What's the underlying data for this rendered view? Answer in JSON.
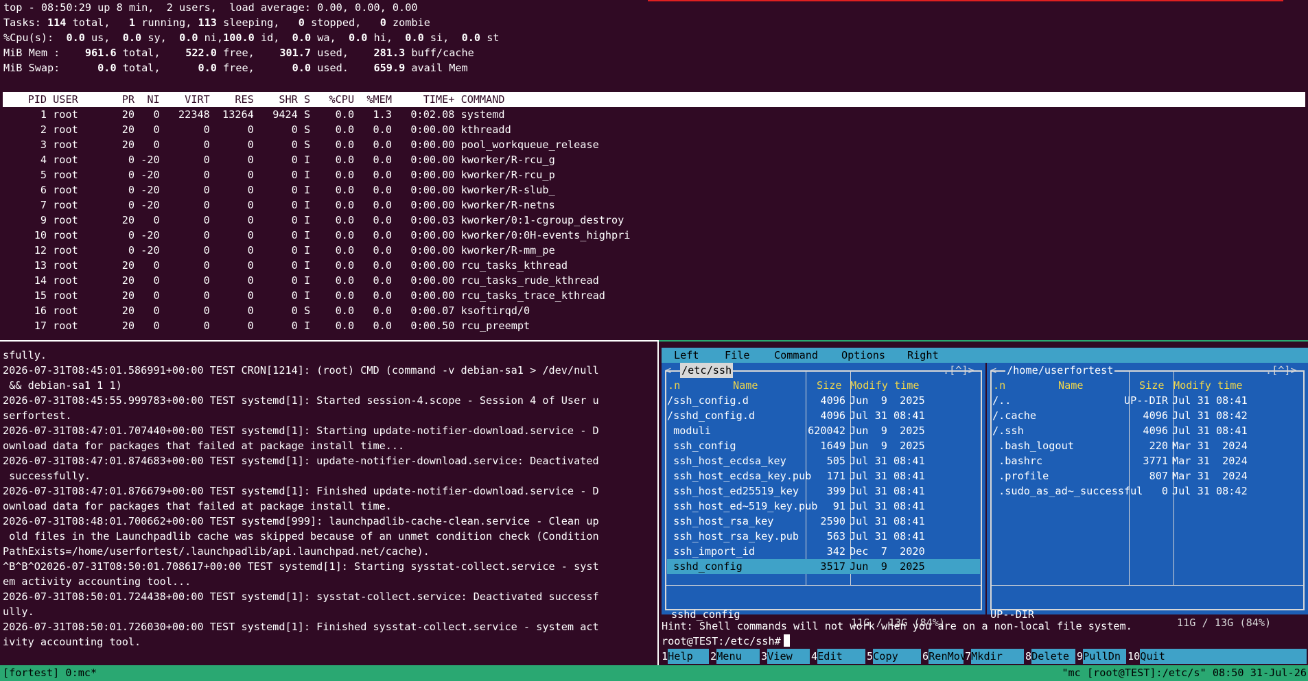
{
  "top": {
    "summary": [
      [
        {
          "t": "top - 08:50:29 up 8 min,  2 users,  load average: 0.00, 0.00, 0.00"
        }
      ],
      [
        {
          "t": "Tasks: "
        },
        {
          "t": "114",
          "b": true
        },
        {
          "t": " total,   "
        },
        {
          "t": "1",
          "b": true
        },
        {
          "t": " running, "
        },
        {
          "t": "113",
          "b": true
        },
        {
          "t": " sleeping,   "
        },
        {
          "t": "0",
          "b": true
        },
        {
          "t": " stopped,   "
        },
        {
          "t": "0",
          "b": true
        },
        {
          "t": " zombie"
        }
      ],
      [
        {
          "t": "%Cpu(s):  "
        },
        {
          "t": "0.0",
          "b": true
        },
        {
          "t": " us,  "
        },
        {
          "t": "0.0",
          "b": true
        },
        {
          "t": " sy,  "
        },
        {
          "t": "0.0",
          "b": true
        },
        {
          "t": " ni,"
        },
        {
          "t": "100.0",
          "b": true
        },
        {
          "t": " id,  "
        },
        {
          "t": "0.0",
          "b": true
        },
        {
          "t": " wa,  "
        },
        {
          "t": "0.0",
          "b": true
        },
        {
          "t": " hi,  "
        },
        {
          "t": "0.0",
          "b": true
        },
        {
          "t": " si,  "
        },
        {
          "t": "0.0",
          "b": true
        },
        {
          "t": " st"
        }
      ],
      [
        {
          "t": "MiB Mem :    "
        },
        {
          "t": "961.6",
          "b": true
        },
        {
          "t": " total,    "
        },
        {
          "t": "522.0",
          "b": true
        },
        {
          "t": " free,    "
        },
        {
          "t": "301.7",
          "b": true
        },
        {
          "t": " used,    "
        },
        {
          "t": "281.3",
          "b": true
        },
        {
          "t": " buff/cache"
        }
      ],
      [
        {
          "t": "MiB Swap:      "
        },
        {
          "t": "0.0",
          "b": true
        },
        {
          "t": " total,      "
        },
        {
          "t": "0.0",
          "b": true
        },
        {
          "t": " free,      "
        },
        {
          "t": "0.0",
          "b": true
        },
        {
          "t": " used.    "
        },
        {
          "t": "659.9",
          "b": true
        },
        {
          "t": " avail Mem"
        }
      ]
    ],
    "columns": [
      "PID",
      "USER",
      "PR",
      "NI",
      "VIRT",
      "RES",
      "SHR",
      "S",
      "%CPU",
      "%MEM",
      "TIME+",
      "COMMAND"
    ],
    "processes": [
      [
        "1",
        "root",
        "20",
        "0",
        "22348",
        "13264",
        "9424",
        "S",
        "0.0",
        "1.3",
        "0:02.08",
        "systemd"
      ],
      [
        "2",
        "root",
        "20",
        "0",
        "0",
        "0",
        "0",
        "S",
        "0.0",
        "0.0",
        "0:00.00",
        "kthreadd"
      ],
      [
        "3",
        "root",
        "20",
        "0",
        "0",
        "0",
        "0",
        "S",
        "0.0",
        "0.0",
        "0:00.00",
        "pool_workqueue_release"
      ],
      [
        "4",
        "root",
        "0",
        "-20",
        "0",
        "0",
        "0",
        "I",
        "0.0",
        "0.0",
        "0:00.00",
        "kworker/R-rcu_g"
      ],
      [
        "5",
        "root",
        "0",
        "-20",
        "0",
        "0",
        "0",
        "I",
        "0.0",
        "0.0",
        "0:00.00",
        "kworker/R-rcu_p"
      ],
      [
        "6",
        "root",
        "0",
        "-20",
        "0",
        "0",
        "0",
        "I",
        "0.0",
        "0.0",
        "0:00.00",
        "kworker/R-slub_"
      ],
      [
        "7",
        "root",
        "0",
        "-20",
        "0",
        "0",
        "0",
        "I",
        "0.0",
        "0.0",
        "0:00.00",
        "kworker/R-netns"
      ],
      [
        "9",
        "root",
        "20",
        "0",
        "0",
        "0",
        "0",
        "I",
        "0.0",
        "0.0",
        "0:00.03",
        "kworker/0:1-cgroup_destroy"
      ],
      [
        "10",
        "root",
        "0",
        "-20",
        "0",
        "0",
        "0",
        "I",
        "0.0",
        "0.0",
        "0:00.00",
        "kworker/0:0H-events_highpri"
      ],
      [
        "12",
        "root",
        "0",
        "-20",
        "0",
        "0",
        "0",
        "I",
        "0.0",
        "0.0",
        "0:00.00",
        "kworker/R-mm_pe"
      ],
      [
        "13",
        "root",
        "20",
        "0",
        "0",
        "0",
        "0",
        "I",
        "0.0",
        "0.0",
        "0:00.00",
        "rcu_tasks_kthread"
      ],
      [
        "14",
        "root",
        "20",
        "0",
        "0",
        "0",
        "0",
        "I",
        "0.0",
        "0.0",
        "0:00.00",
        "rcu_tasks_rude_kthread"
      ],
      [
        "15",
        "root",
        "20",
        "0",
        "0",
        "0",
        "0",
        "I",
        "0.0",
        "0.0",
        "0:00.00",
        "rcu_tasks_trace_kthread"
      ],
      [
        "16",
        "root",
        "20",
        "0",
        "0",
        "0",
        "0",
        "S",
        "0.0",
        "0.0",
        "0:00.07",
        "ksoftirqd/0"
      ],
      [
        "17",
        "root",
        "20",
        "0",
        "0",
        "0",
        "0",
        "I",
        "0.0",
        "0.0",
        "0:00.50",
        "rcu_preempt"
      ]
    ]
  },
  "log": [
    "sfully.",
    "2026-07-31T08:45:01.586991+00:00 TEST CRON[1214]: (root) CMD (command -v debian-sa1 > /dev/null",
    " && debian-sa1 1 1)",
    "2026-07-31T08:45:55.999783+00:00 TEST systemd[1]: Started session-4.scope - Session 4 of User u",
    "serfortest.",
    "2026-07-31T08:47:01.707440+00:00 TEST systemd[1]: Starting update-notifier-download.service - D",
    "ownload data for packages that failed at package install time...",
    "2026-07-31T08:47:01.874683+00:00 TEST systemd[1]: update-notifier-download.service: Deactivated",
    " successfully.",
    "2026-07-31T08:47:01.876679+00:00 TEST systemd[1]: Finished update-notifier-download.service - D",
    "ownload data for packages that failed at package install time.",
    "2026-07-31T08:48:01.700662+00:00 TEST systemd[999]: launchpadlib-cache-clean.service - Clean up",
    " old files in the Launchpadlib cache was skipped because of an unmet condition check (Condition",
    "PathExists=/home/userfortest/.launchpadlib/api.launchpad.net/cache).",
    "^B^B^O2026-07-31T08:50:01.708617+00:00 TEST systemd[1]: Starting sysstat-collect.service - syst",
    "em activity accounting tool...",
    "2026-07-31T08:50:01.724438+00:00 TEST systemd[1]: sysstat-collect.service: Deactivated successf",
    "ully.",
    "2026-07-31T08:50:01.726030+00:00 TEST systemd[1]: Finished sysstat-collect.service - system act",
    "ivity accounting tool."
  ],
  "mc": {
    "menu": [
      "Left",
      "File",
      "Command",
      "Options",
      "Right"
    ],
    "left": {
      "path": "/etc/ssh",
      "corner_left": "<-",
      "corner_right": ".[^]>",
      "col_n": ".n",
      "col_name": "Name",
      "col_size": "Size",
      "col_mtime": "Modify time",
      "files": [
        {
          "name": "/ssh_config.d",
          "size": "4096",
          "date": "Jun  9  2025"
        },
        {
          "name": "/sshd_config.d",
          "size": "4096",
          "date": "Jul 31 08:41"
        },
        {
          "name": " moduli",
          "size": "620042",
          "date": "Jun  9  2025"
        },
        {
          "name": " ssh_config",
          "size": "1649",
          "date": "Jun  9  2025"
        },
        {
          "name": " ssh_host_ecdsa_key",
          "size": "505",
          "date": "Jul 31 08:41"
        },
        {
          "name": " ssh_host_ecdsa_key.pub",
          "size": "171",
          "date": "Jul 31 08:41"
        },
        {
          "name": " ssh_host_ed25519_key",
          "size": "399",
          "date": "Jul 31 08:41"
        },
        {
          "name": " ssh_host_ed~519_key.pub",
          "size": "91",
          "date": "Jul 31 08:41"
        },
        {
          "name": " ssh_host_rsa_key",
          "size": "2590",
          "date": "Jul 31 08:41"
        },
        {
          "name": " ssh_host_rsa_key.pub",
          "size": "563",
          "date": "Jul 31 08:41"
        },
        {
          "name": " ssh_import_id",
          "size": "342",
          "date": "Dec  7  2020"
        },
        {
          "name": " sshd_config",
          "size": "3517",
          "date": "Jun  9  2025",
          "selected": true
        }
      ],
      "mini_status": "sshd_config",
      "disk": "11G / 13G (84%)"
    },
    "right": {
      "path": "/home/userfortest",
      "corner_left": "<-",
      "corner_right": ".[^]>",
      "col_n": ".n",
      "col_name": "Name",
      "col_size": "Size",
      "col_mtime": "Modify time",
      "files": [
        {
          "name": "/..",
          "size": "UP--DIR",
          "date": "Jul 31 08:41"
        },
        {
          "name": "/.cache",
          "size": "4096",
          "date": "Jul 31 08:42"
        },
        {
          "name": "/.ssh",
          "size": "4096",
          "date": "Jul 31 08:41"
        },
        {
          "name": " .bash_logout",
          "size": "220",
          "date": "Mar 31  2024"
        },
        {
          "name": " .bashrc",
          "size": "3771",
          "date": "Mar 31  2024"
        },
        {
          "name": " .profile",
          "size": "807",
          "date": "Mar 31  2024"
        },
        {
          "name": " .sudo_as_ad~_successful",
          "size": "0",
          "date": "Jul 31 08:42"
        }
      ],
      "mini_status": "UP--DIR",
      "disk": "11G / 13G (84%)"
    },
    "hint": "Hint: Shell commands will not work when you are on a non-local file system.",
    "prompt": "root@TEST:/etc/ssh#",
    "fkeys": [
      {
        "num": "1",
        "label": "Help"
      },
      {
        "num": "2",
        "label": "Menu"
      },
      {
        "num": "3",
        "label": "View"
      },
      {
        "num": "4",
        "label": "Edit"
      },
      {
        "num": "5",
        "label": "Copy"
      },
      {
        "num": "6",
        "label": "RenMov"
      },
      {
        "num": "7",
        "label": "Mkdir"
      },
      {
        "num": "8",
        "label": "Delete"
      },
      {
        "num": "9",
        "label": "PullDn"
      },
      {
        "num": "10",
        "label": "Quit"
      }
    ]
  },
  "statusbar": {
    "left": "[fortest] 0:mc*",
    "right": "\"mc [root@TEST]:/etc/s\" 08:50 31-Jul-26"
  },
  "colors": {
    "terminal_bg": "#300a24",
    "mc_panel_bg": "#1d5eb5",
    "mc_accent": "#3fa2c8",
    "mc_header": "#f0d64a",
    "tmux_status": "#2aa872"
  }
}
